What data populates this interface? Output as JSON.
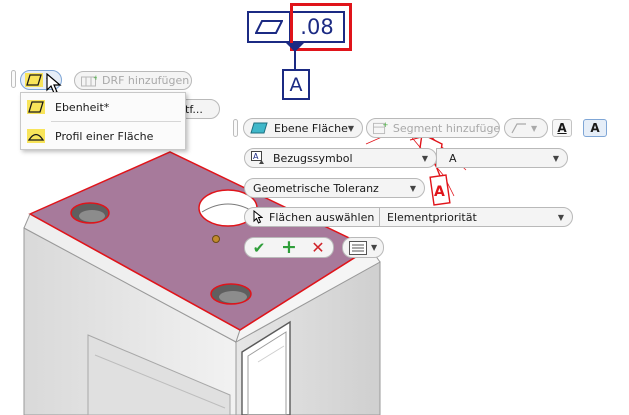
{
  "annotation": {
    "tolerance_value": ".08",
    "datum_label": "A",
    "datum_flag_label": "A"
  },
  "mini_toolbar_top": {
    "drf_button_label": "DRF hinzufügen",
    "hidden_button_fragment": "tf..."
  },
  "symbol_menu": {
    "items": [
      {
        "label": "Ebenheit*",
        "icon": "flatness-icon"
      },
      {
        "label": "Profil einer Fläche",
        "icon": "surface-profile-icon"
      }
    ]
  },
  "panel": {
    "geometry_type_label": "Ebene Fläche",
    "segment_button_label": "Segment hinzufügen",
    "datum_symbol_label": "Bezugssymbol",
    "datum_value": "A",
    "tolerance_type_label": "Geometrische Toleranz",
    "select_faces_label": "Flächen auswählen",
    "priority_label": "Elementpriorität"
  },
  "colors": {
    "face_fill": "#a77a9b",
    "highlight_red": "#e0141a",
    "annotation_blue": "#1b2a83",
    "ok_green": "#2f9e3a",
    "cancel_red": "#d0242a"
  }
}
